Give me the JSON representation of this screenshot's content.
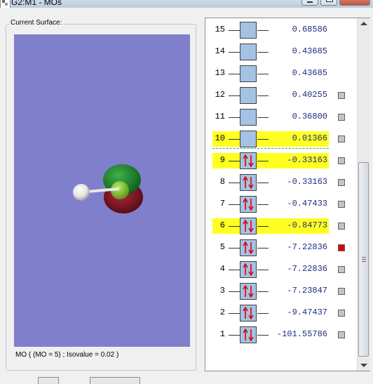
{
  "window": {
    "title": "G2:M1 - MOs"
  },
  "surface_panel": {
    "caption": "Current Surface:",
    "status": "MO ( (MO = 5) ; Isovalue = 0.02 )",
    "background_color": "#7f7fcb",
    "molecule": {
      "atoms": [
        "hydrogen",
        "chlorine"
      ],
      "lobe_colors": [
        "#1e8a2a",
        "#7a1020"
      ]
    }
  },
  "orbitals": {
    "highlight_color": "#ffff22",
    "box_color": "#a4c3e4",
    "selected_color": "#e00000",
    "items": [
      {
        "num": "15",
        "energy": "0.68586",
        "occupied": false,
        "highlight": false,
        "checkbox": false,
        "selected": false
      },
      {
        "num": "14",
        "energy": "0.43685",
        "occupied": false,
        "highlight": false,
        "checkbox": false,
        "selected": false
      },
      {
        "num": "13",
        "energy": "0.43685",
        "occupied": false,
        "highlight": false,
        "checkbox": false,
        "selected": false
      },
      {
        "num": "12",
        "energy": "0.40255",
        "occupied": false,
        "highlight": false,
        "checkbox": true,
        "selected": false
      },
      {
        "num": "11",
        "energy": "0.36800",
        "occupied": false,
        "highlight": false,
        "checkbox": true,
        "selected": false
      },
      {
        "num": "10",
        "energy": "0.01366",
        "occupied": false,
        "highlight": true,
        "checkbox": true,
        "selected": false
      },
      {
        "num": "9",
        "energy": "-0.33163",
        "occupied": true,
        "highlight": true,
        "checkbox": true,
        "selected": false
      },
      {
        "num": "8",
        "energy": "-0.33163",
        "occupied": true,
        "highlight": false,
        "checkbox": true,
        "selected": false
      },
      {
        "num": "7",
        "energy": "-0.47433",
        "occupied": true,
        "highlight": false,
        "checkbox": true,
        "selected": false
      },
      {
        "num": "6",
        "energy": "-0.84773",
        "occupied": true,
        "highlight": true,
        "checkbox": true,
        "selected": false
      },
      {
        "num": "5",
        "energy": "-7.22836",
        "occupied": true,
        "highlight": false,
        "checkbox": true,
        "selected": true
      },
      {
        "num": "4",
        "energy": "-7.22836",
        "occupied": true,
        "highlight": false,
        "checkbox": true,
        "selected": false
      },
      {
        "num": "3",
        "energy": "-7.23847",
        "occupied": true,
        "highlight": false,
        "checkbox": true,
        "selected": false
      },
      {
        "num": "2",
        "energy": "-9.47437",
        "occupied": true,
        "highlight": false,
        "checkbox": true,
        "selected": false
      },
      {
        "num": "1",
        "energy": "-101.55786",
        "occupied": true,
        "highlight": false,
        "checkbox": true,
        "selected": false
      }
    ]
  }
}
